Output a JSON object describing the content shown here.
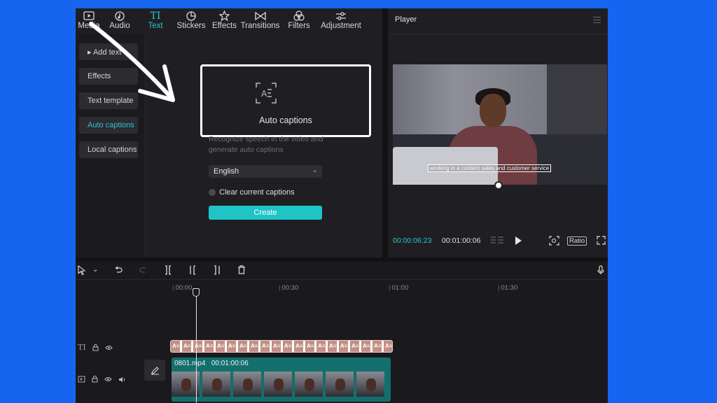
{
  "tabs": [
    {
      "label": "Media",
      "icon": "media-icon"
    },
    {
      "label": "Audio",
      "icon": "audio-icon"
    },
    {
      "label": "Text",
      "icon": "text-icon",
      "active": true
    },
    {
      "label": "Stickers",
      "icon": "stickers-icon"
    },
    {
      "label": "Effects",
      "icon": "effects-icon"
    },
    {
      "label": "Transitions",
      "icon": "transitions-icon"
    },
    {
      "label": "Filters",
      "icon": "filters-icon"
    },
    {
      "label": "Adjustment",
      "icon": "adjustment-icon"
    }
  ],
  "sidebar": {
    "items": [
      {
        "label": "▸ Add text"
      },
      {
        "label": "Effects"
      },
      {
        "label": "Text template"
      },
      {
        "label": "Auto captions",
        "active": true
      },
      {
        "label": "Local captions"
      }
    ]
  },
  "auto_captions": {
    "title": "Auto captions",
    "description": "Recognize speech in the video and generate auto captions",
    "language": "English",
    "clear_label": "Clear current captions",
    "create_label": "Create"
  },
  "player": {
    "title": "Player",
    "caption_text": "working in a content sales and customer service",
    "current_time": "00:00:06:23",
    "duration": "00:01:00:06",
    "ratio_label": "Ratio"
  },
  "timeline": {
    "ticks": [
      "00:00",
      "00:30",
      "01:00",
      "01:30"
    ],
    "text_clip_label": "A≡",
    "video_clip": {
      "name": "0801.mp4",
      "duration": "00:01:00:06"
    }
  },
  "colors": {
    "accent": "#2ec4c9",
    "background": "#1565f0",
    "create_button": "#1fc4c7"
  }
}
